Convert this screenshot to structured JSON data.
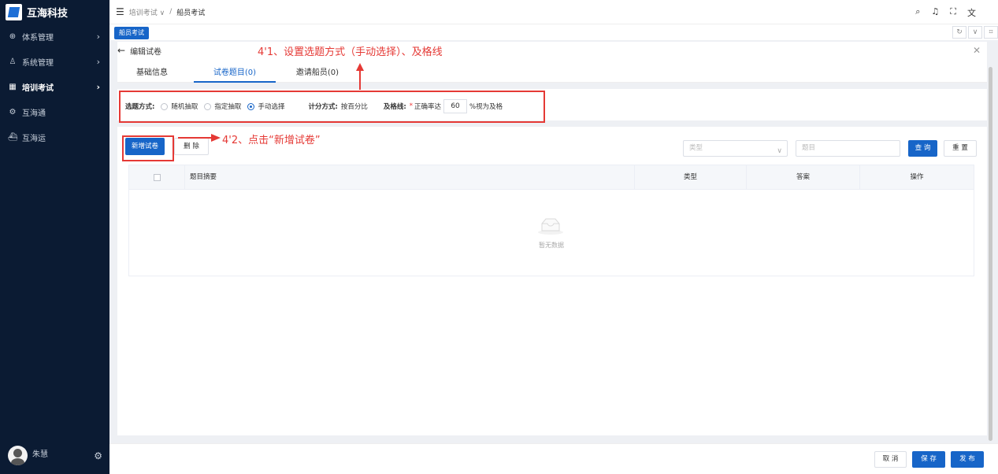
{
  "app": {
    "name": "互海科技"
  },
  "sidebar": {
    "items": [
      {
        "icon": "system-icon",
        "label": "体系管理",
        "chevron": "›"
      },
      {
        "icon": "user-group-icon",
        "label": "系统管理",
        "chevron": "›"
      },
      {
        "icon": "grid-icon",
        "label": "培训考试",
        "chevron": "›",
        "active": true
      },
      {
        "icon": "settings-icon",
        "label": "互海通"
      },
      {
        "icon": "ship-icon",
        "label": "互海运"
      }
    ],
    "user": {
      "name": "朱慧"
    }
  },
  "topbar": {
    "breadcrumb_parent": "培训考试 ∨",
    "breadcrumb_sep": "/",
    "breadcrumb_current": "船员考试"
  },
  "tabstrip": {
    "active_tab": "船员考试"
  },
  "card": {
    "title": "编辑试卷",
    "tabs": [
      "基础信息",
      "试卷题目(0)",
      "邀请船员(0)"
    ],
    "active_tab_index": 1
  },
  "settings": {
    "select_label": "选题方式:",
    "options": [
      "随机抽取",
      "指定抽取",
      "手动选择"
    ],
    "selected_option": "手动选择",
    "score_label": "计分方式:",
    "score_value": "按百分比",
    "pass_label": "及格线:",
    "pass_required_mark": "*",
    "pass_prefix": "正确率达",
    "pass_value": "60",
    "pass_suffix": "%视为及格"
  },
  "toolbar": {
    "add_label": "新增试卷",
    "delete_label": "删 除",
    "type_placeholder": "类型",
    "topic_placeholder": "题目",
    "query_label": "查 询",
    "reset_label": "重 置"
  },
  "table": {
    "columns": [
      "题目摘要",
      "类型",
      "答案",
      "操作"
    ],
    "empty_text": "暂无数据"
  },
  "footer": {
    "cancel_label": "取 消",
    "save_label": "保 存",
    "publish_label": "发 布"
  },
  "annotations": {
    "step1": "4'1、设置选题方式（手动选择）、及格线",
    "step2": "4'2、点击“新增试卷”"
  },
  "colors": {
    "primary": "#1765c8",
    "sidebar": "#0b1b33",
    "annotation": "#e53935"
  }
}
